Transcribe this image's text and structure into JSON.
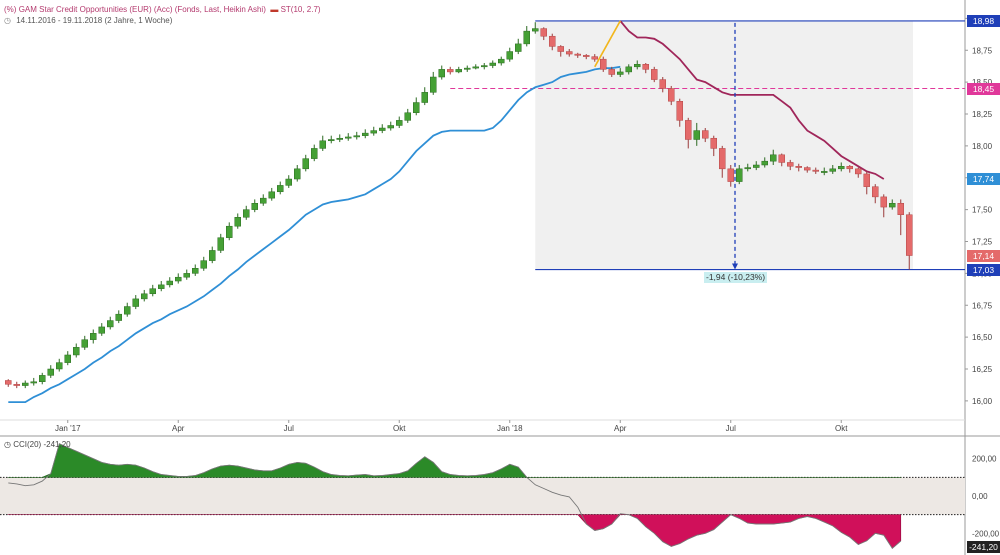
{
  "header": {
    "instrument_prefix": "(%)",
    "instrument": "GAM Star Credit Opportunities (EUR) (Acc) (Fonds, Last, Heikin Ashi)",
    "indicator": "ST(10, 2.7)",
    "period": "14.11.2016 - 19.11.2018",
    "resolution": "(2 Jahre, 1 Woche)",
    "cci_label": "CCI(20)",
    "cci_value": "-241,20"
  },
  "colors": {
    "up": "#45a035",
    "down": "#e46a6a",
    "supertrend_up": "#2f8fd6",
    "supertrend_down": "#a0265a",
    "measure": "#1f3fb8",
    "dashed": "#e0389a",
    "cci_pos": "#2b8a28",
    "cci_neg": "#d0105a"
  },
  "price_axis": {
    "ticks": [
      "19,00",
      "18,75",
      "18,50",
      "18,25",
      "18,00",
      "17,75",
      "17,50",
      "17,25",
      "17,00",
      "16,75",
      "16,50",
      "16,25",
      "16,00"
    ],
    "tick_values": [
      19.0,
      18.75,
      18.5,
      18.25,
      18.0,
      17.75,
      17.5,
      17.25,
      17.0,
      16.75,
      16.5,
      16.25,
      16.0
    ]
  },
  "time_axis": {
    "labels": [
      "Jan '17",
      "Apr",
      "Jul",
      "Okt",
      "Jan '18",
      "Apr",
      "Jul",
      "Okt"
    ],
    "label_weeks": [
      7,
      20,
      33,
      46,
      59,
      72,
      85,
      98
    ]
  },
  "badges": [
    {
      "text": "18,98",
      "value": 18.98,
      "color": "#1f3fb8"
    },
    {
      "text": "18,45",
      "value": 18.45,
      "color": "#e0389a"
    },
    {
      "text": "17,74",
      "value": 17.74,
      "color": "#2f8fd6"
    },
    {
      "text": "17,14",
      "value": 17.14,
      "color": "#e46a6a"
    },
    {
      "text": "17,03",
      "value": 17.03,
      "color": "#1f3fb8"
    }
  ],
  "measurement": {
    "label": "-1,94 (-10,23%)",
    "high": 18.98,
    "low": 17.03,
    "start_week": 62,
    "end_week": 105
  },
  "dashed_level": 18.45,
  "cci_axis": {
    "ticks": [
      "200,00",
      "0,00",
      "-200,00"
    ],
    "tick_values": [
      200,
      0,
      -200
    ],
    "badge": "-241,20",
    "range": [
      -300,
      300
    ],
    "upper_line": 100,
    "lower_line": -100
  },
  "chart_data": {
    "type": "candlestick",
    "title": "GAM Star Credit Opportunities (EUR) (Acc) (Fonds, Last, Heikin Ashi)",
    "ylim": [
      15.85,
      19.05
    ],
    "candles": [
      [
        16.16,
        16.13,
        16.17,
        16.11
      ],
      [
        16.13,
        16.12,
        16.15,
        16.1
      ],
      [
        16.12,
        16.14,
        16.16,
        16.1
      ],
      [
        16.14,
        16.15,
        16.18,
        16.12
      ],
      [
        16.15,
        16.2,
        16.22,
        16.13
      ],
      [
        16.2,
        16.25,
        16.28,
        16.18
      ],
      [
        16.25,
        16.3,
        16.33,
        16.23
      ],
      [
        16.3,
        16.36,
        16.39,
        16.28
      ],
      [
        16.36,
        16.42,
        16.45,
        16.34
      ],
      [
        16.42,
        16.48,
        16.51,
        16.4
      ],
      [
        16.48,
        16.53,
        16.56,
        16.45
      ],
      [
        16.53,
        16.58,
        16.61,
        16.51
      ],
      [
        16.58,
        16.63,
        16.66,
        16.56
      ],
      [
        16.63,
        16.68,
        16.71,
        16.61
      ],
      [
        16.68,
        16.74,
        16.77,
        16.66
      ],
      [
        16.74,
        16.8,
        16.83,
        16.72
      ],
      [
        16.8,
        16.84,
        16.87,
        16.78
      ],
      [
        16.84,
        16.88,
        16.91,
        16.82
      ],
      [
        16.88,
        16.91,
        16.94,
        16.86
      ],
      [
        16.91,
        16.94,
        16.97,
        16.89
      ],
      [
        16.94,
        16.97,
        17.0,
        16.92
      ],
      [
        16.97,
        17.0,
        17.03,
        16.95
      ],
      [
        17.0,
        17.04,
        17.07,
        16.98
      ],
      [
        17.04,
        17.1,
        17.13,
        17.02
      ],
      [
        17.1,
        17.18,
        17.21,
        17.08
      ],
      [
        17.18,
        17.28,
        17.31,
        17.16
      ],
      [
        17.28,
        17.37,
        17.4,
        17.26
      ],
      [
        17.37,
        17.44,
        17.47,
        17.35
      ],
      [
        17.44,
        17.5,
        17.53,
        17.42
      ],
      [
        17.5,
        17.55,
        17.58,
        17.48
      ],
      [
        17.55,
        17.59,
        17.62,
        17.53
      ],
      [
        17.59,
        17.64,
        17.67,
        17.57
      ],
      [
        17.64,
        17.69,
        17.72,
        17.62
      ],
      [
        17.69,
        17.74,
        17.77,
        17.67
      ],
      [
        17.74,
        17.82,
        17.85,
        17.72
      ],
      [
        17.82,
        17.9,
        17.93,
        17.8
      ],
      [
        17.9,
        17.98,
        18.01,
        17.88
      ],
      [
        17.98,
        18.04,
        18.08,
        17.96
      ],
      [
        18.04,
        18.05,
        18.08,
        18.02
      ],
      [
        18.05,
        18.06,
        18.09,
        18.03
      ],
      [
        18.06,
        18.07,
        18.1,
        18.04
      ],
      [
        18.07,
        18.08,
        18.11,
        18.05
      ],
      [
        18.08,
        18.1,
        18.13,
        18.06
      ],
      [
        18.1,
        18.12,
        18.15,
        18.08
      ],
      [
        18.12,
        18.14,
        18.17,
        18.1
      ],
      [
        18.14,
        18.16,
        18.19,
        18.12
      ],
      [
        18.16,
        18.2,
        18.23,
        18.14
      ],
      [
        18.2,
        18.26,
        18.29,
        18.18
      ],
      [
        18.26,
        18.34,
        18.38,
        18.24
      ],
      [
        18.34,
        18.42,
        18.46,
        18.32
      ],
      [
        18.42,
        18.54,
        18.58,
        18.4
      ],
      [
        18.54,
        18.6,
        18.63,
        18.52
      ],
      [
        18.6,
        18.58,
        18.62,
        18.56
      ],
      [
        18.58,
        18.6,
        18.62,
        18.57
      ],
      [
        18.6,
        18.61,
        18.63,
        18.58
      ],
      [
        18.61,
        18.62,
        18.64,
        18.6
      ],
      [
        18.62,
        18.63,
        18.65,
        18.6
      ],
      [
        18.63,
        18.65,
        18.67,
        18.61
      ],
      [
        18.65,
        18.68,
        18.7,
        18.63
      ],
      [
        18.68,
        18.74,
        18.77,
        18.66
      ],
      [
        18.74,
        18.8,
        18.84,
        18.72
      ],
      [
        18.8,
        18.9,
        18.94,
        18.78
      ],
      [
        18.9,
        18.92,
        18.97,
        18.88
      ],
      [
        18.92,
        18.86,
        18.93,
        18.83
      ],
      [
        18.86,
        18.78,
        18.88,
        18.75
      ],
      [
        18.78,
        18.74,
        18.79,
        18.7
      ],
      [
        18.74,
        18.72,
        18.76,
        18.7
      ],
      [
        18.72,
        18.71,
        18.73,
        18.69
      ],
      [
        18.71,
        18.7,
        18.72,
        18.68
      ],
      [
        18.7,
        18.68,
        18.72,
        18.66
      ],
      [
        18.68,
        18.6,
        18.7,
        18.58
      ],
      [
        18.6,
        18.56,
        18.62,
        18.54
      ],
      [
        18.56,
        18.58,
        18.61,
        18.54
      ],
      [
        18.58,
        18.62,
        18.64,
        18.56
      ],
      [
        18.62,
        18.64,
        18.67,
        18.6
      ],
      [
        18.64,
        18.6,
        18.65,
        18.57
      ],
      [
        18.6,
        18.52,
        18.62,
        18.5
      ],
      [
        18.52,
        18.45,
        18.54,
        18.42
      ],
      [
        18.45,
        18.35,
        18.47,
        18.32
      ],
      [
        18.35,
        18.2,
        18.37,
        18.15
      ],
      [
        18.2,
        18.05,
        18.22,
        17.98
      ],
      [
        18.05,
        18.12,
        18.18,
        18.0
      ],
      [
        18.12,
        18.06,
        18.14,
        18.03
      ],
      [
        18.06,
        17.98,
        18.08,
        17.92
      ],
      [
        17.98,
        17.82,
        18.0,
        17.75
      ],
      [
        17.82,
        17.72,
        17.85,
        17.68
      ],
      [
        17.72,
        17.82,
        17.85,
        17.7
      ],
      [
        17.82,
        17.83,
        17.86,
        17.8
      ],
      [
        17.83,
        17.85,
        17.88,
        17.81
      ],
      [
        17.85,
        17.88,
        17.91,
        17.83
      ],
      [
        17.88,
        17.93,
        17.97,
        17.85
      ],
      [
        17.93,
        17.87,
        17.94,
        17.84
      ],
      [
        17.87,
        17.84,
        17.89,
        17.81
      ],
      [
        17.84,
        17.83,
        17.86,
        17.8
      ],
      [
        17.83,
        17.81,
        17.84,
        17.79
      ],
      [
        17.81,
        17.8,
        17.83,
        17.78
      ],
      [
        17.8,
        17.8,
        17.83,
        17.77
      ],
      [
        17.8,
        17.82,
        17.85,
        17.78
      ],
      [
        17.82,
        17.84,
        17.87,
        17.8
      ],
      [
        17.84,
        17.82,
        17.85,
        17.79
      ],
      [
        17.82,
        17.78,
        17.83,
        17.75
      ],
      [
        17.78,
        17.68,
        17.8,
        17.62
      ],
      [
        17.68,
        17.6,
        17.7,
        17.55
      ],
      [
        17.6,
        17.52,
        17.62,
        17.44
      ],
      [
        17.52,
        17.55,
        17.58,
        17.5
      ],
      [
        17.55,
        17.46,
        17.58,
        17.3
      ],
      [
        17.46,
        17.14,
        17.48,
        17.03
      ]
    ],
    "supertrend": [
      [
        0,
        15.99
      ],
      [
        1,
        15.99
      ],
      [
        2,
        15.99
      ],
      [
        3,
        16.03
      ],
      [
        4,
        16.06
      ],
      [
        5,
        16.1
      ],
      [
        6,
        16.13
      ],
      [
        7,
        16.17
      ],
      [
        8,
        16.21
      ],
      [
        9,
        16.25
      ],
      [
        10,
        16.3
      ],
      [
        11,
        16.34
      ],
      [
        12,
        16.39
      ],
      [
        13,
        16.43
      ],
      [
        14,
        16.48
      ],
      [
        15,
        16.53
      ],
      [
        16,
        16.57
      ],
      [
        17,
        16.61
      ],
      [
        18,
        16.64
      ],
      [
        19,
        16.68
      ],
      [
        20,
        16.71
      ],
      [
        21,
        16.74
      ],
      [
        22,
        16.78
      ],
      [
        23,
        16.82
      ],
      [
        24,
        16.87
      ],
      [
        25,
        16.92
      ],
      [
        26,
        16.98
      ],
      [
        27,
        17.03
      ],
      [
        28,
        17.09
      ],
      [
        29,
        17.14
      ],
      [
        30,
        17.19
      ],
      [
        31,
        17.24
      ],
      [
        32,
        17.29
      ],
      [
        33,
        17.34
      ],
      [
        34,
        17.4
      ],
      [
        35,
        17.46
      ],
      [
        36,
        17.5
      ],
      [
        37,
        17.54
      ],
      [
        38,
        17.56
      ],
      [
        39,
        17.57
      ],
      [
        40,
        17.58
      ],
      [
        41,
        17.6
      ],
      [
        42,
        17.62
      ],
      [
        43,
        17.66
      ],
      [
        44,
        17.7
      ],
      [
        45,
        17.74
      ],
      [
        46,
        17.8
      ],
      [
        47,
        17.88
      ],
      [
        48,
        17.96
      ],
      [
        49,
        18.02
      ],
      [
        50,
        18.08
      ],
      [
        51,
        18.11
      ],
      [
        52,
        18.12
      ],
      [
        53,
        18.12
      ],
      [
        54,
        18.12
      ],
      [
        55,
        18.12
      ],
      [
        56,
        18.12
      ],
      [
        57,
        18.14
      ],
      [
        58,
        18.2
      ],
      [
        59,
        18.28
      ],
      [
        60,
        18.36
      ],
      [
        61,
        18.42
      ],
      [
        62,
        18.46
      ],
      [
        63,
        18.48
      ],
      [
        64,
        18.5
      ],
      [
        65,
        18.54
      ],
      [
        66,
        18.56
      ],
      [
        67,
        18.57
      ],
      [
        68,
        18.58
      ],
      [
        69,
        18.6
      ],
      [
        70,
        18.61
      ],
      [
        71,
        18.61
      ],
      [
        72,
        18.62
      ],
      [
        72,
        18.98
      ],
      [
        73,
        18.9
      ],
      [
        74,
        18.85
      ],
      [
        75,
        18.85
      ],
      [
        76,
        18.84
      ],
      [
        77,
        18.8
      ],
      [
        78,
        18.74
      ],
      [
        79,
        18.68
      ],
      [
        80,
        18.6
      ],
      [
        81,
        18.52
      ],
      [
        82,
        18.5
      ],
      [
        83,
        18.46
      ],
      [
        84,
        18.42
      ],
      [
        85,
        18.4
      ],
      [
        86,
        18.4
      ],
      [
        87,
        18.4
      ],
      [
        88,
        18.4
      ],
      [
        89,
        18.4
      ],
      [
        90,
        18.4
      ],
      [
        91,
        18.35
      ],
      [
        92,
        18.3
      ],
      [
        93,
        18.2
      ],
      [
        94,
        18.12
      ],
      [
        95,
        18.08
      ],
      [
        96,
        18.04
      ],
      [
        97,
        17.98
      ],
      [
        98,
        17.92
      ],
      [
        99,
        17.88
      ],
      [
        100,
        17.84
      ],
      [
        101,
        17.8
      ],
      [
        102,
        17.78
      ],
      [
        103,
        17.74
      ]
    ],
    "cci": [
      [
        0,
        70
      ],
      [
        1,
        65
      ],
      [
        2,
        55
      ],
      [
        3,
        60
      ],
      [
        4,
        80
      ],
      [
        5,
        120
      ],
      [
        6,
        280
      ],
      [
        7,
        260
      ],
      [
        8,
        240
      ],
      [
        9,
        220
      ],
      [
        10,
        200
      ],
      [
        11,
        180
      ],
      [
        12,
        170
      ],
      [
        13,
        165
      ],
      [
        14,
        170
      ],
      [
        15,
        165
      ],
      [
        16,
        150
      ],
      [
        17,
        130
      ],
      [
        18,
        115
      ],
      [
        19,
        110
      ],
      [
        20,
        105
      ],
      [
        21,
        105
      ],
      [
        22,
        110
      ],
      [
        23,
        125
      ],
      [
        24,
        145
      ],
      [
        25,
        160
      ],
      [
        26,
        165
      ],
      [
        27,
        160
      ],
      [
        28,
        150
      ],
      [
        29,
        140
      ],
      [
        30,
        135
      ],
      [
        31,
        135
      ],
      [
        32,
        150
      ],
      [
        33,
        170
      ],
      [
        34,
        180
      ],
      [
        35,
        175
      ],
      [
        36,
        155
      ],
      [
        37,
        130
      ],
      [
        38,
        115
      ],
      [
        39,
        110
      ],
      [
        40,
        108
      ],
      [
        41,
        112
      ],
      [
        42,
        115
      ],
      [
        43,
        108
      ],
      [
        44,
        110
      ],
      [
        45,
        115
      ],
      [
        46,
        120
      ],
      [
        47,
        135
      ],
      [
        48,
        175
      ],
      [
        49,
        210
      ],
      [
        50,
        180
      ],
      [
        51,
        130
      ],
      [
        52,
        115
      ],
      [
        53,
        110
      ],
      [
        54,
        108
      ],
      [
        55,
        110
      ],
      [
        56,
        115
      ],
      [
        57,
        125
      ],
      [
        58,
        145
      ],
      [
        59,
        170
      ],
      [
        60,
        155
      ],
      [
        61,
        100
      ],
      [
        62,
        60
      ],
      [
        63,
        40
      ],
      [
        64,
        20
      ],
      [
        65,
        5
      ],
      [
        66,
        -5
      ],
      [
        67,
        -60
      ],
      [
        68,
        -150
      ],
      [
        69,
        -185
      ],
      [
        70,
        -175
      ],
      [
        71,
        -150
      ],
      [
        72,
        -95
      ],
      [
        73,
        -100
      ],
      [
        74,
        -120
      ],
      [
        75,
        -165
      ],
      [
        76,
        -200
      ],
      [
        77,
        -245
      ],
      [
        78,
        -270
      ],
      [
        79,
        -255
      ],
      [
        80,
        -230
      ],
      [
        81,
        -210
      ],
      [
        82,
        -200
      ],
      [
        83,
        -180
      ],
      [
        84,
        -140
      ],
      [
        85,
        -100
      ],
      [
        86,
        -120
      ],
      [
        87,
        -145
      ],
      [
        88,
        -150
      ],
      [
        89,
        -150
      ],
      [
        90,
        -150
      ],
      [
        91,
        -145
      ],
      [
        92,
        -140
      ],
      [
        93,
        -120
      ],
      [
        94,
        -110
      ],
      [
        95,
        -120
      ],
      [
        96,
        -140
      ],
      [
        97,
        -160
      ],
      [
        98,
        -195
      ],
      [
        99,
        -220
      ],
      [
        100,
        -260
      ],
      [
        101,
        -240
      ],
      [
        102,
        -200
      ],
      [
        103,
        -210
      ],
      [
        104,
        -280
      ],
      [
        105,
        -241.2
      ]
    ]
  }
}
